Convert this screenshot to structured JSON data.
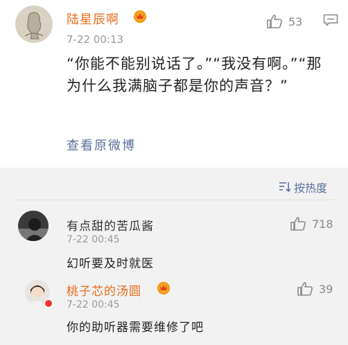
{
  "post": {
    "username": "陆星辰啊",
    "timestamp": "7-22 00:13",
    "like_count": "53",
    "text": "“你能不能别说话了。”“我没有啊。”“那为什么我满脑子都是你的声音？”",
    "view_original": "查看原微博"
  },
  "sort_label": "按热度",
  "comments": [
    {
      "username": "有点甜的苦瓜酱",
      "timestamp": "7-22 00:45",
      "like_count": "718",
      "text": "幻听要及时就医"
    },
    {
      "username": "桃子芯的汤圆",
      "timestamp": "7-22 00:45",
      "like_count": "39",
      "text": "你的助听器需要维修了吧"
    }
  ],
  "colors": {
    "vip_username": "#e86b1b",
    "link": "#5b6f9b",
    "sub_background": "#f2f2f2"
  },
  "icons": [
    "thumbs-up-icon",
    "reply-icon",
    "vip-crown-icon",
    "sort-icon",
    "badge-icon"
  ]
}
